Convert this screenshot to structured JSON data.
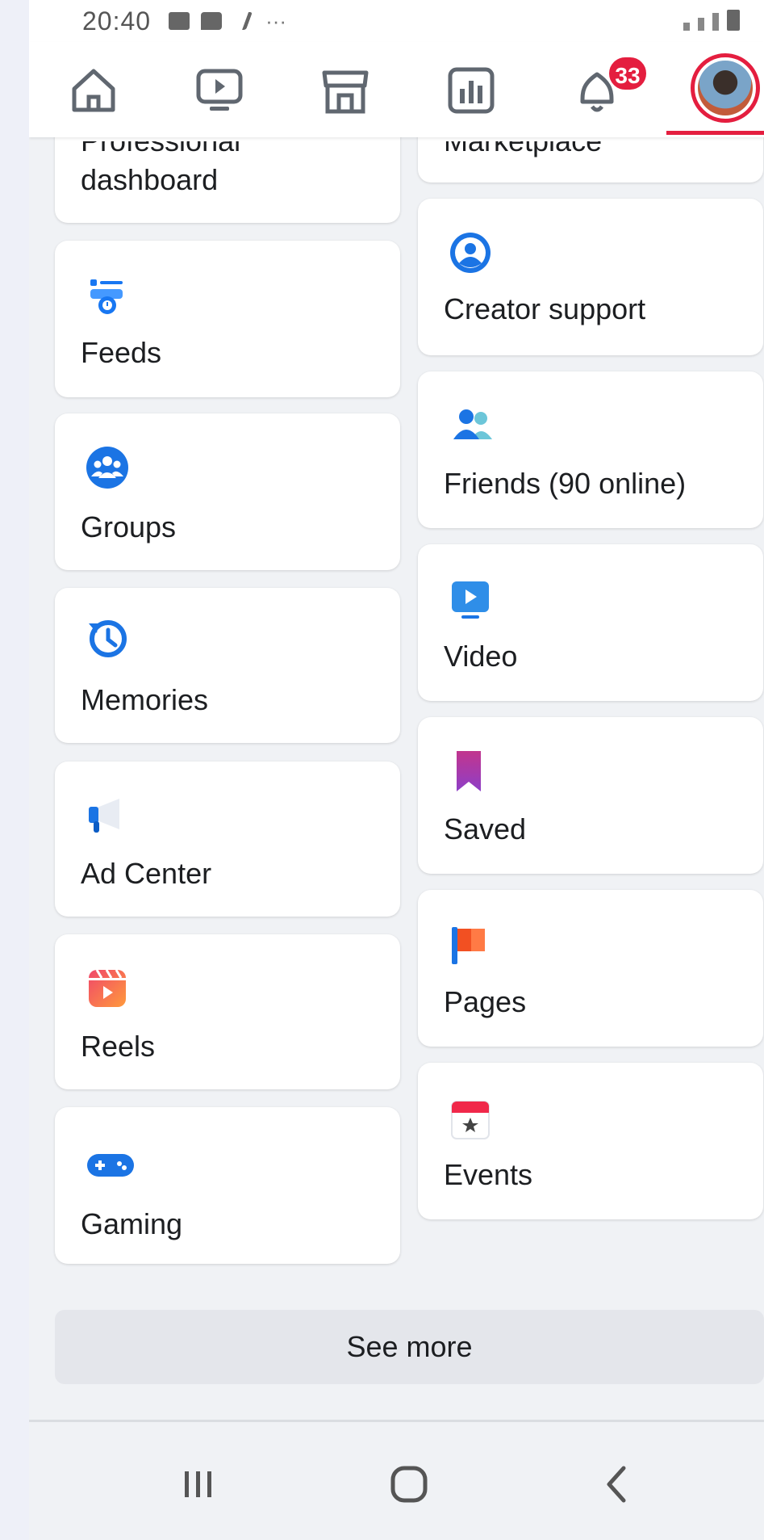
{
  "status_bar": {
    "time": "20:40",
    "more": "···"
  },
  "nav": {
    "notification_count": "33"
  },
  "left_column": [
    {
      "label": "dashboard",
      "icon": "professional-dashboard-icon"
    },
    {
      "label": "Feeds",
      "icon": "feeds-icon"
    },
    {
      "label": "Groups",
      "icon": "groups-icon"
    },
    {
      "label": "Memories",
      "icon": "memories-icon"
    },
    {
      "label": "Ad Center",
      "icon": "ad-center-icon"
    },
    {
      "label": "Reels",
      "icon": "reels-icon"
    },
    {
      "label": "Gaming",
      "icon": "gaming-icon"
    }
  ],
  "left_partial_label": "Professional",
  "right_partial_label": "Marketplace",
  "right_column": [
    {
      "label": "Creator support",
      "icon": "creator-support-icon"
    },
    {
      "label": "Friends (90 online)",
      "icon": "friends-icon"
    },
    {
      "label": "Video",
      "icon": "video-icon"
    },
    {
      "label": "Saved",
      "icon": "saved-icon"
    },
    {
      "label": "Pages",
      "icon": "pages-icon"
    },
    {
      "label": "Events",
      "icon": "events-icon"
    }
  ],
  "see_more_label": "See more",
  "colors": {
    "accent": "#1877f2",
    "badge": "#e41e3f",
    "background": "#f0f2f5"
  }
}
